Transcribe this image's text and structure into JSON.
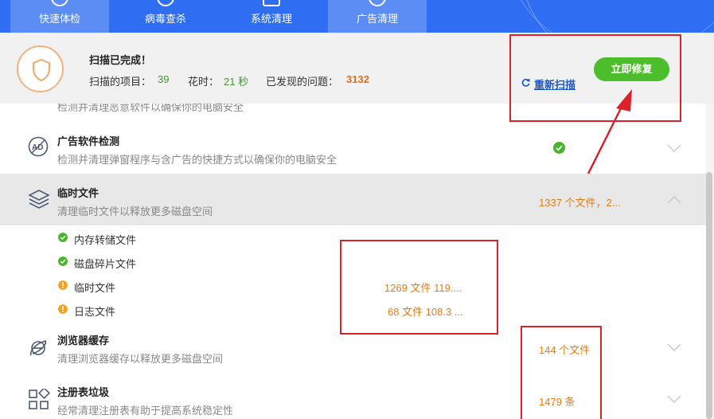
{
  "nav": {
    "tabs": [
      {
        "label": "快速体检",
        "icon": "magnify-icon"
      },
      {
        "label": "病毒查杀",
        "icon": "virus-icon"
      },
      {
        "label": "系统清理",
        "icon": "broom-icon"
      },
      {
        "label": "广告清理",
        "icon": "ad-icon"
      }
    ]
  },
  "status": {
    "title": "扫描已完成！",
    "items_label": "扫描的项目：",
    "items_value": "39",
    "time_label": "花时：",
    "time_value": "21 秒",
    "issues_label": "已发现的问题：",
    "issues_value": "3132",
    "rescan_label": "重新扫描",
    "fix_label": "立即修复"
  },
  "rows": {
    "partial_desc": "检测并清理恶意软件以确保你的电脑安全",
    "adware": {
      "title": "广告软件检测",
      "desc": "检测并清理弹窗程序与含广告的快捷方式以确保你的电脑安全"
    },
    "temp": {
      "title": "临时文件",
      "desc": "清理临时文件以释放更多磁盘空间",
      "result": "1337 个文件，2..."
    },
    "temp_sub": [
      {
        "label": "内存转储文件",
        "status": "ok",
        "result": ""
      },
      {
        "label": "磁盘碎片文件",
        "status": "ok",
        "result": ""
      },
      {
        "label": "临时文件",
        "status": "warn",
        "result": "1269 文件 119...."
      },
      {
        "label": "日志文件",
        "status": "warn",
        "result": "68 文件 108.3 ..."
      }
    ],
    "browser": {
      "title": "浏览器缓存",
      "desc": "清理浏览器缓存以释放更多磁盘空间",
      "result": "144 个文件"
    },
    "registry": {
      "title": "注册表垃圾",
      "desc": "经常清理注册表有助于提高系统稳定性",
      "result": "1479 条"
    }
  },
  "colors": {
    "nav_bg": "#2f6ef2",
    "accent_green": "#4cbd2b",
    "accent_orange": "#e07d17",
    "annotation_red": "#d9222a"
  }
}
